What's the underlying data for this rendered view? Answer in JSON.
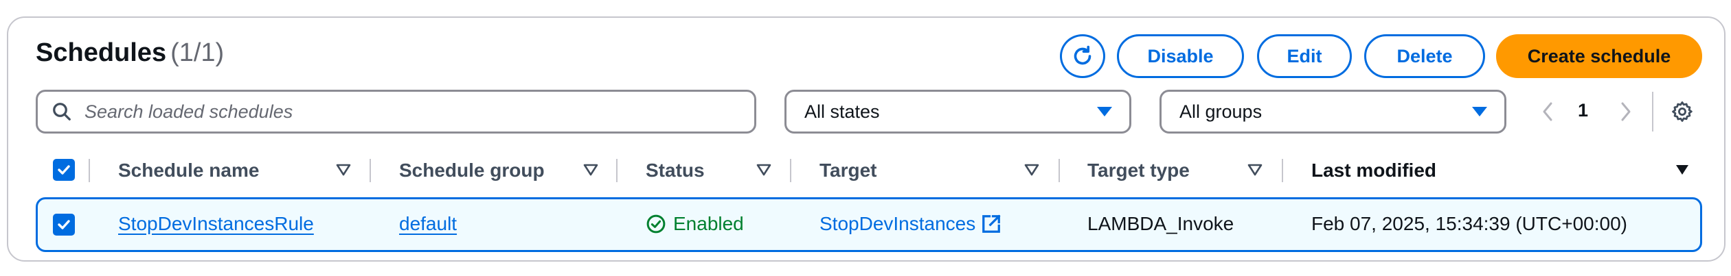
{
  "header": {
    "title": "Schedules",
    "count": "(1/1)"
  },
  "actions": {
    "refresh_icon": "refresh-icon",
    "disable_label": "Disable",
    "edit_label": "Edit",
    "delete_label": "Delete",
    "create_label": "Create schedule"
  },
  "filters": {
    "search_placeholder": "Search loaded schedules",
    "state_value": "All states",
    "group_value": "All groups"
  },
  "pagination": {
    "current_page": "1"
  },
  "table": {
    "columns": [
      {
        "label": "Schedule name"
      },
      {
        "label": "Schedule group"
      },
      {
        "label": "Status"
      },
      {
        "label": "Target"
      },
      {
        "label": "Target type"
      },
      {
        "label": "Last modified"
      }
    ],
    "rows": [
      {
        "selected": true,
        "name": "StopDevInstancesRule",
        "group": "default",
        "status": "Enabled",
        "target": "StopDevInstances",
        "target_type": "LAMBDA_Invoke",
        "last_modified": "Feb 07, 2025, 15:34:39 (UTC+00:00)"
      }
    ]
  },
  "colors": {
    "accent": "#006ce0",
    "primary_button": "#ff9900",
    "success": "#00802f",
    "selected_row_bg": "#f0fbff"
  }
}
